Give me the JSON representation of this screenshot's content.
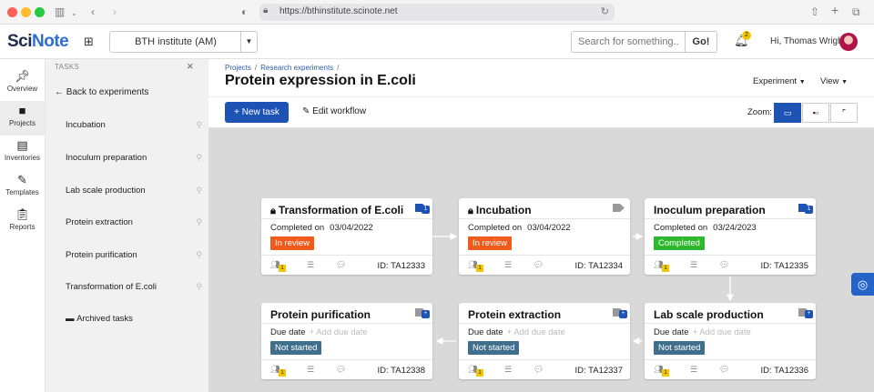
{
  "browser": {
    "url": "https://bthinstitute.scinote.net"
  },
  "header": {
    "logo_main": "Sci",
    "logo_accent": "Note",
    "team": "BTH institute (AM)",
    "search_placeholder": "Search for something...",
    "search_go": "Go!",
    "notifications": "2",
    "greeting": "Hi, Thomas Wright"
  },
  "leftnav": [
    {
      "label": "Overview",
      "icon": "pin-icon"
    },
    {
      "label": "Projects",
      "icon": "folder-icon"
    },
    {
      "label": "Inventories",
      "icon": "inventory-icon"
    },
    {
      "label": "Templates",
      "icon": "templates-icon"
    },
    {
      "label": "Reports",
      "icon": "reports-icon"
    }
  ],
  "tasks_panel": {
    "heading": "TASKS",
    "back": "Back to experiments",
    "items": [
      "Incubation",
      "Inoculum preparation",
      "Lab scale production",
      "Protein extraction",
      "Protein purification",
      "Transformation of E.coli"
    ],
    "archived": "Archived tasks"
  },
  "main": {
    "breadcrumbs": [
      "Projects",
      "Research experiments"
    ],
    "title": "Protein expression in E.coli",
    "experiment_dd": "Experiment",
    "view_dd": "View",
    "new_task": "+ New task",
    "edit_workflow": "Edit workflow",
    "zoom_label": "Zoom:"
  },
  "cards": [
    {
      "title": "Transformation of E.coli",
      "locked": true,
      "meta_label": "Completed on",
      "meta_value": "03/04/2022",
      "status": "In review",
      "status_color": "#f05a1a",
      "id": "ID: TA12333",
      "user_count": "1",
      "tag_count": "1",
      "tag_color": "#1e53b6"
    },
    {
      "title": "Incubation",
      "locked": true,
      "meta_label": "Completed on",
      "meta_value": "03/04/2022",
      "status": "In review",
      "status_color": "#f05a1a",
      "id": "ID: TA12334",
      "user_count": "1",
      "tag_count": "",
      "tag_color": "#999999"
    },
    {
      "title": "Inoculum preparation",
      "locked": false,
      "meta_label": "Completed on",
      "meta_value": "03/24/2023",
      "status": "Completed",
      "status_color": "#2db82d",
      "id": "ID: TA12335",
      "user_count": "1",
      "tag_count": "1",
      "tag_color": "#1e53b6"
    },
    {
      "title": "Protein purification",
      "locked": false,
      "meta_label": "Due date",
      "meta_value": "+ Add due date",
      "status": "Not started",
      "status_color": "#3f6f8c",
      "id": "ID: TA12338",
      "user_count": "1",
      "tag_count": "+",
      "tag_color": "#999999"
    },
    {
      "title": "Protein extraction",
      "locked": false,
      "meta_label": "Due date",
      "meta_value": "+ Add due date",
      "status": "Not started",
      "status_color": "#3f6f8c",
      "id": "ID: TA12337",
      "user_count": "1",
      "tag_count": "+",
      "tag_color": "#999999"
    },
    {
      "title": "Lab scale production",
      "locked": false,
      "meta_label": "Due date",
      "meta_value": "+ Add due date",
      "status": "Not started",
      "status_color": "#3f6f8c",
      "id": "ID: TA12336",
      "user_count": "1",
      "tag_count": "+",
      "tag_color": "#999999"
    }
  ]
}
